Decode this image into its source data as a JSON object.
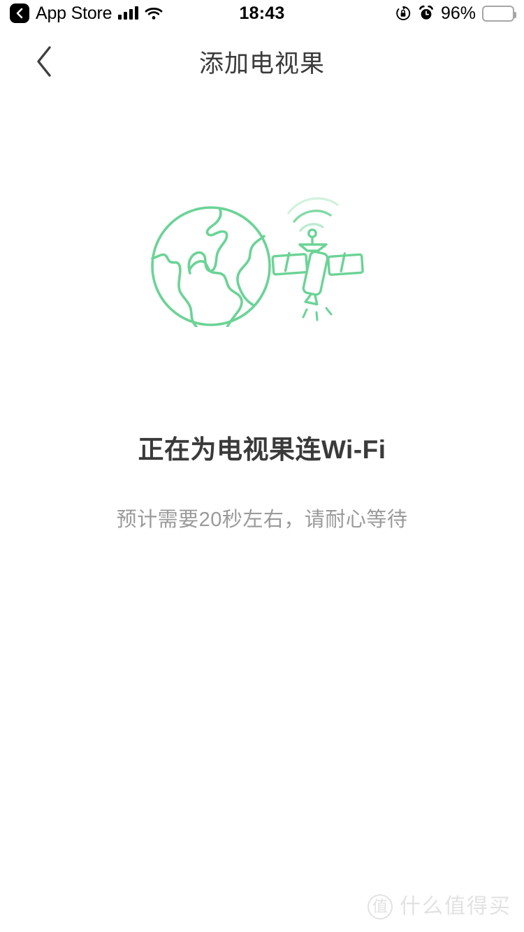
{
  "status_bar": {
    "back_app_label": "App Store",
    "back_chip_icon": "chevron-left-icon",
    "signal_icon": "cellular-signal-icon",
    "wifi_icon": "wifi-icon",
    "time": "18:43",
    "rotation_lock_icon": "rotation-lock-icon",
    "alarm_icon": "alarm-clock-icon",
    "battery_percent": "96%",
    "battery_icon": "battery-full-icon",
    "battery_level": 96
  },
  "nav_bar": {
    "back_icon": "chevron-left-icon",
    "title": "添加电视果"
  },
  "illustration": {
    "globe_icon": "globe-icon",
    "satellite_icon": "satellite-icon",
    "signal_waves_icon": "signal-waves-icon",
    "accent_color": "#6BD396"
  },
  "content": {
    "headline": "正在为电视果连Wi-Fi",
    "subline": "预计需要20秒左右，请耐心等待"
  },
  "watermark": {
    "badge_text": "值",
    "text": "什么值得买",
    "color": "#e2e2e2"
  }
}
